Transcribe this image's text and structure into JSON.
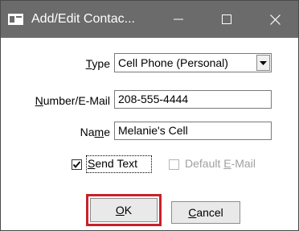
{
  "window": {
    "title": "Add/Edit Contac...",
    "minimize_glyph": "—",
    "maximize_glyph": "☐",
    "close_glyph": "✕"
  },
  "form": {
    "type": {
      "label_pre": "",
      "label_u": "T",
      "label_post": "ype",
      "value": "Cell Phone (Personal)"
    },
    "number": {
      "label_pre": "",
      "label_u": "N",
      "label_post": "umber/E-Mail",
      "value": "208-555-4444"
    },
    "name": {
      "label_pre": "Na",
      "label_u": "m",
      "label_post": "e",
      "value": "Melanie's Cell"
    },
    "send_text": {
      "label_pre": "",
      "label_u": "S",
      "label_post": "end Text",
      "checked": true
    },
    "default_email": {
      "label_pre": "Default ",
      "label_u": "E",
      "label_post": "-Mail",
      "checked": false,
      "disabled": true
    }
  },
  "buttons": {
    "ok": {
      "label_pre": "",
      "label_u": "O",
      "label_post": "K"
    },
    "cancel": {
      "label_pre": "",
      "label_u": "C",
      "label_post": "ancel"
    }
  },
  "colors": {
    "titlebar": "#6b6b6b",
    "highlight": "#c9202a"
  },
  "icons": {
    "app": "app-icon",
    "dropdown": "chevron-down-icon",
    "check": "checkmark-icon"
  }
}
